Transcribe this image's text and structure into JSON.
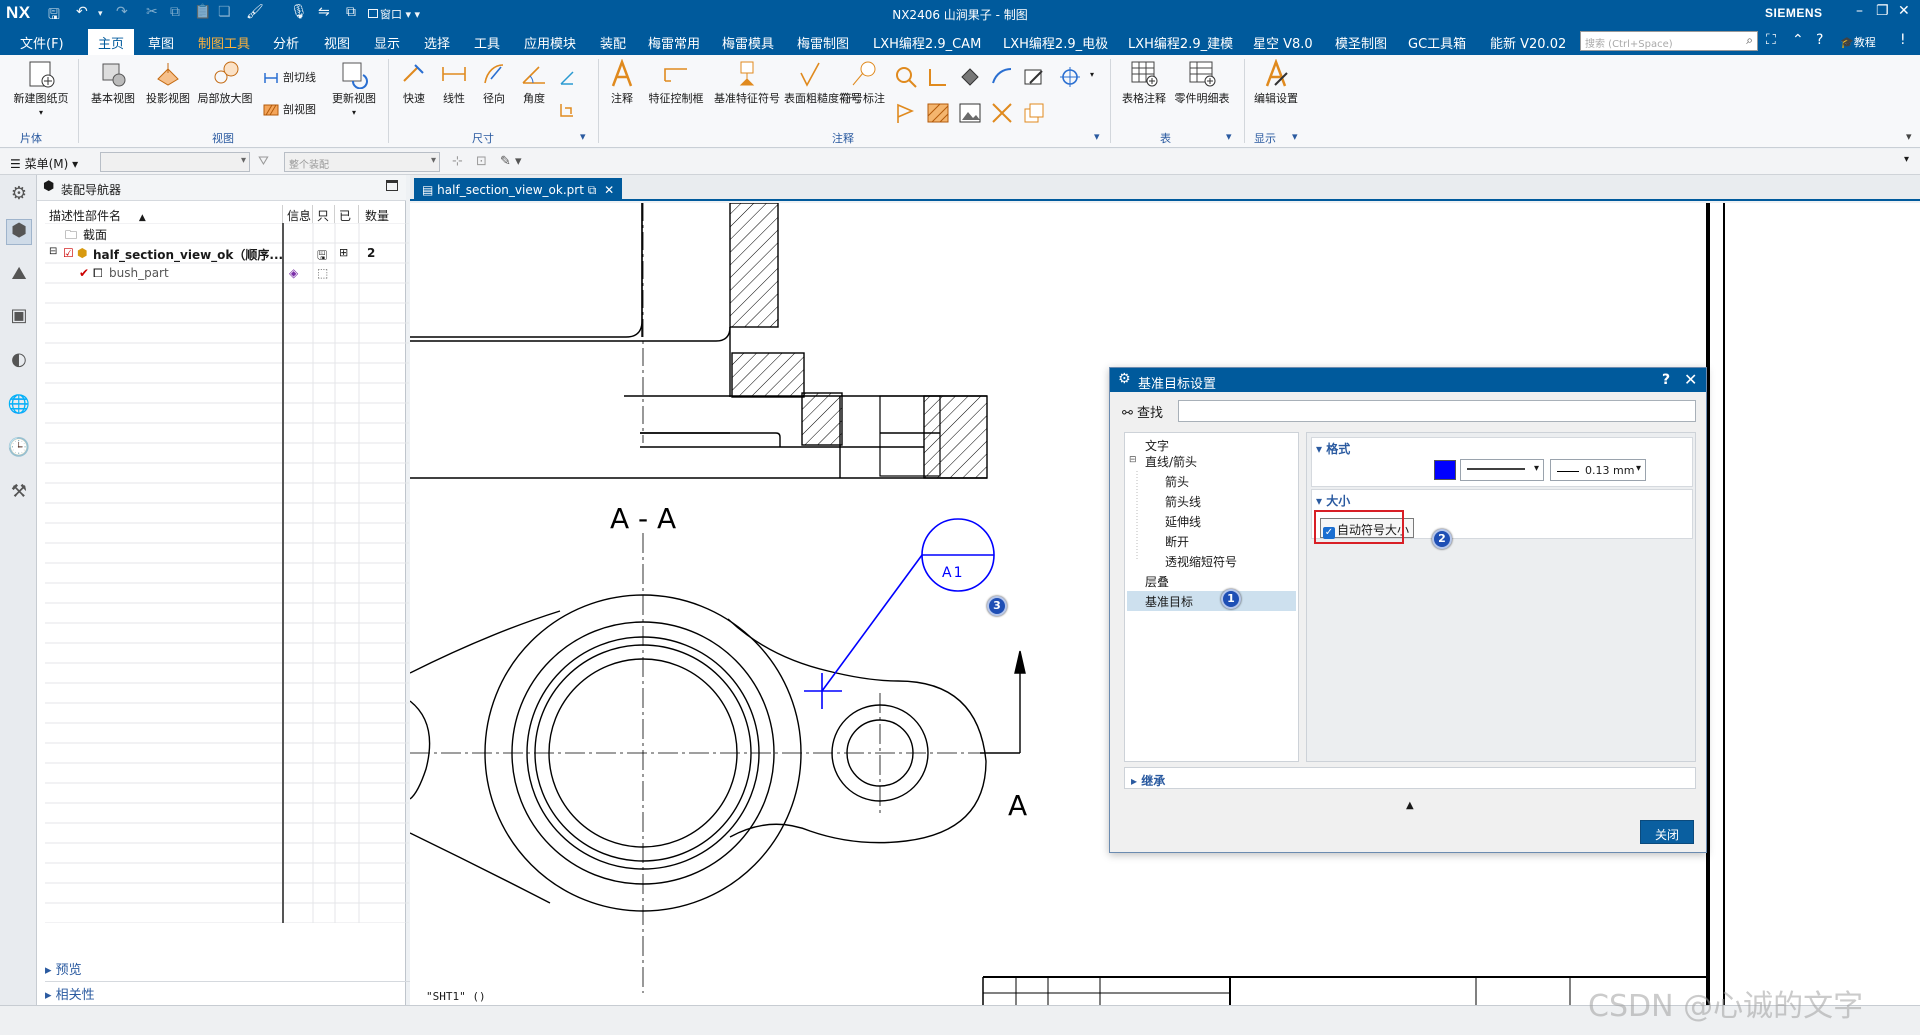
{
  "titlebar": {
    "logo": "NX",
    "title": "NX2406 山涧果子 - 制图",
    "brand": "SIEMENS",
    "window_label": "窗口"
  },
  "menubar": {
    "file": "文件(F)",
    "tabs": [
      "主页",
      "草图",
      "制图工具",
      "分析",
      "视图",
      "显示",
      "选择",
      "工具",
      "应用模块",
      "装配",
      "梅雷常用",
      "梅雷模具",
      "梅雷制图",
      "LXH编程2.9_CAM",
      "LXH编程2.9_电极",
      "LXH编程2.9_建模",
      "星空 V8.0",
      "模圣制图",
      "GC工具箱",
      "能新 V20.02"
    ],
    "search_placeholder": "搜索 (Ctrl+Space)",
    "tutorial": "教程"
  },
  "ribbon": {
    "sheet_new": "新建图纸页",
    "group_sheet": "片体",
    "base_view": "基本视图",
    "proj_view": "投影视图",
    "detail_view": "局部放大图",
    "section_line": "剖切线",
    "section_view": "剖视图",
    "update_view": "更新视图",
    "group_view": "视图",
    "rapid": "快速",
    "linear": "线性",
    "radial": "径向",
    "angular": "角度",
    "group_dim": "尺寸",
    "note": "注释",
    "fcf": "特征控制框",
    "datum_feature": "基准特征符号",
    "surface_finish": "表面粗糙度符号",
    "id_symbol": "符号标注",
    "group_annotation": "注释",
    "tabular_note": "表格注释",
    "parts_list": "零件明细表",
    "group_table": "表",
    "edit_settings": "编辑设置",
    "group_display": "显示"
  },
  "toolbar2": {
    "menu": "菜单(M)",
    "filter_placeholder": "",
    "assembly_scope": "整个装配"
  },
  "navigator": {
    "title": "装配导航器",
    "columns": [
      "描述性部件名",
      "信息",
      "只",
      "已",
      "数量"
    ],
    "rows": [
      {
        "name": "截面"
      },
      {
        "name": "half_section_view_ok（顺序...",
        "qty": "2"
      },
      {
        "name": "bush_part"
      }
    ],
    "preview": "预览",
    "dependencies": "相关性"
  },
  "document_tab": "half_section_view_ok.prt",
  "canvas": {
    "section_label": "A - A",
    "section_letter": "A",
    "datum_target": "A1",
    "sheet": "\"SHT1\" ()"
  },
  "dialog": {
    "title": "基准目标设置",
    "help": "?",
    "find_label": "查找",
    "tree": [
      "文字",
      "直线/箭头",
      "箭头",
      "箭头线",
      "延伸线",
      "断开",
      "透视缩短符号",
      "层叠",
      "基准目标"
    ],
    "section_format": "格式",
    "line_width": "0.13 mm",
    "section_size": "大小",
    "auto_size": "自动符号大小",
    "auto_size_checked": true,
    "inherit": "继承",
    "close": "关闭",
    "color": "#0000ff"
  },
  "badges": [
    "1",
    "2",
    "3"
  ],
  "watermark": "CSDN @心诚的文字"
}
